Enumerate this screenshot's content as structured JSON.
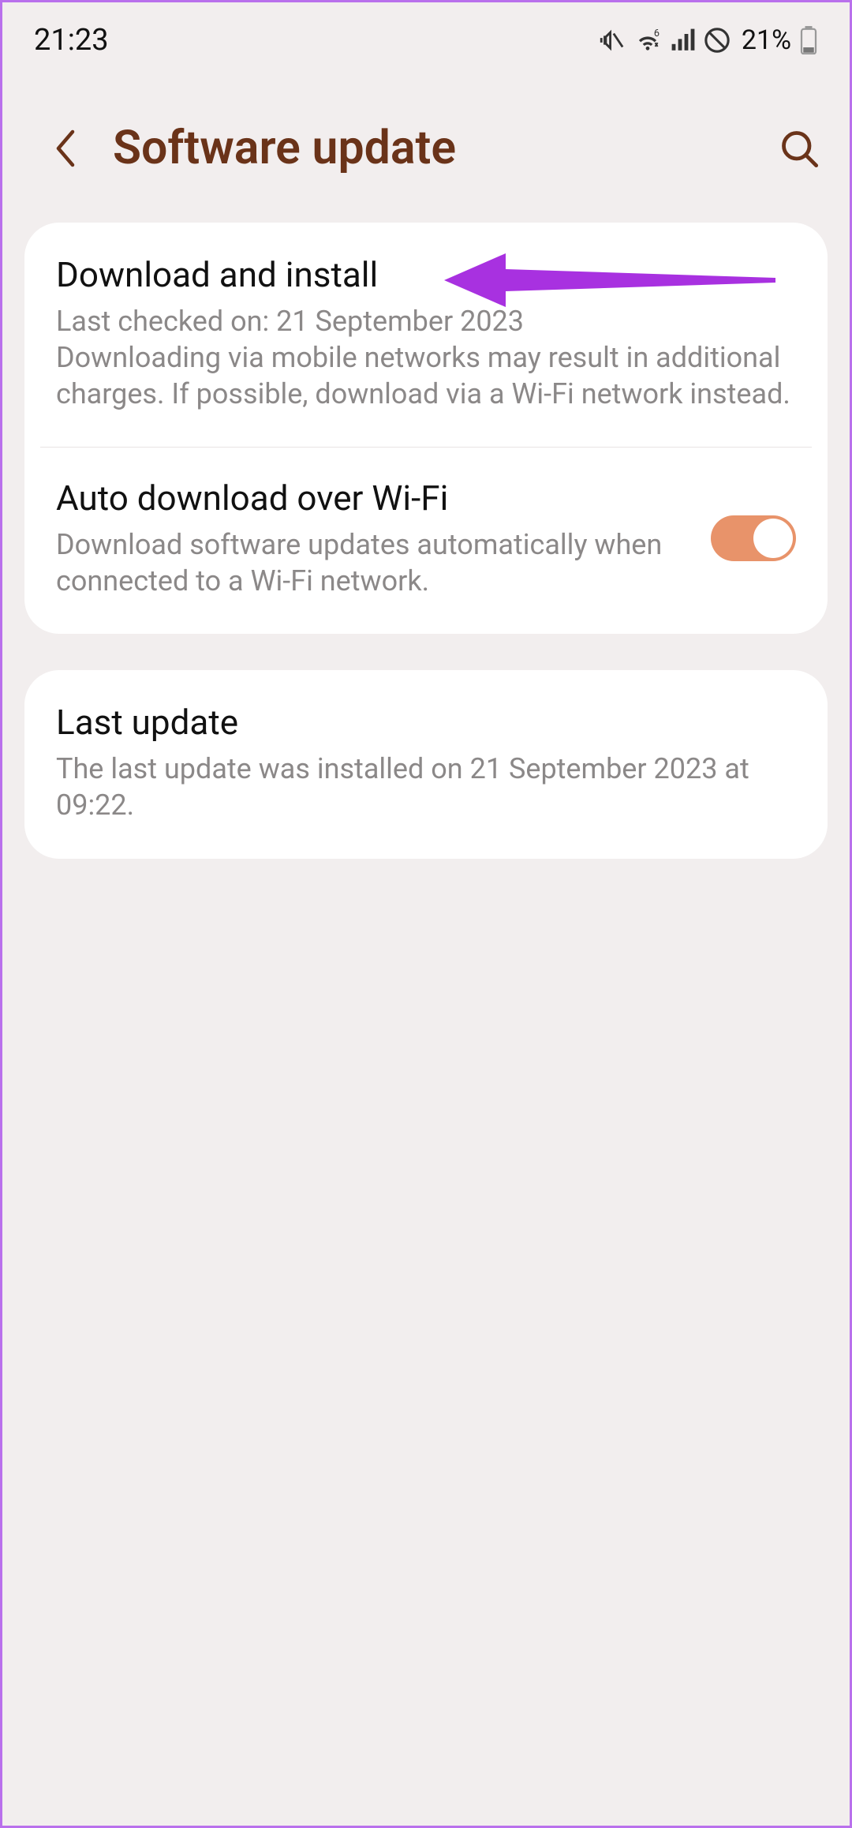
{
  "status": {
    "time": "21:23",
    "battery_text": "21%",
    "icons": {
      "mute": "vibrate-mute-icon",
      "wifi": "wifi-icon",
      "signal": "cell-signal-icon",
      "dnd": "do-not-disturb-icon",
      "battery": "battery-icon"
    }
  },
  "header": {
    "title": "Software update"
  },
  "card1": {
    "download": {
      "title": "Download and install",
      "desc": "Last checked on: 21 September 2023\nDownloading via mobile networks may result in additional charges. If possible, download via a Wi-Fi network instead."
    },
    "auto": {
      "title": "Auto download over Wi-Fi",
      "desc": "Download software updates automatically when connected to a Wi-Fi network.",
      "toggle_on": true
    }
  },
  "card2": {
    "last": {
      "title": "Last update",
      "desc": "The last update was installed on 21 September 2023 at 09:22."
    }
  },
  "annotation": {
    "arrow_color": "#a831e0"
  }
}
